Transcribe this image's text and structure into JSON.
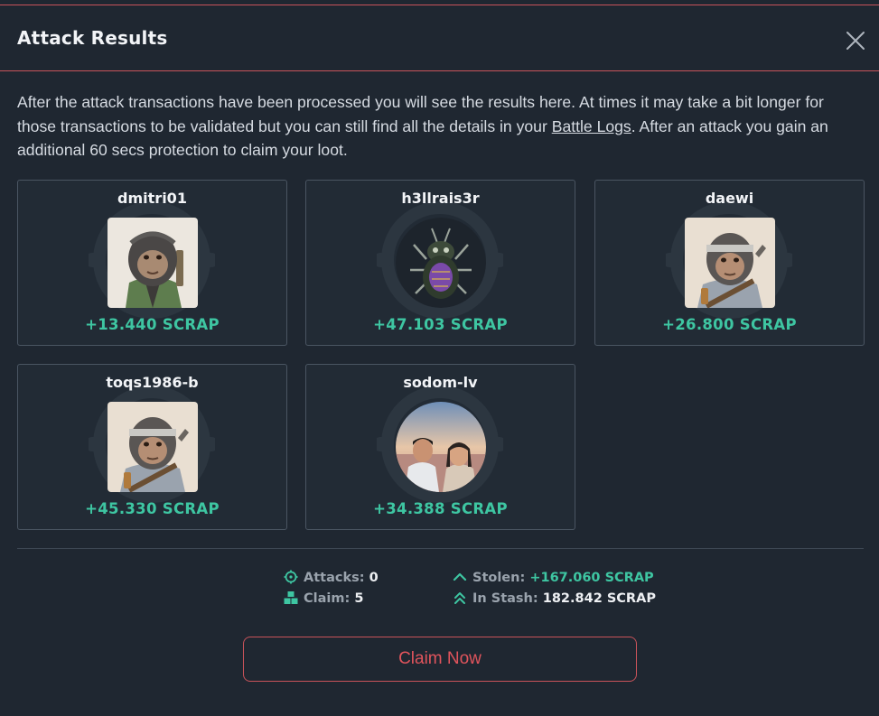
{
  "modal": {
    "title": "Attack Results",
    "close_icon": "close-icon",
    "description_part1": "After the attack transactions have been processed you will see the results here. At times it may take a bit longer for those transactions to be validated but you can still find all the details in your ",
    "battle_logs_link": "Battle Logs",
    "description_part2": ". After an attack you gain an additional 60 secs protection to claim your loot."
  },
  "results": [
    {
      "username": "dmitri01",
      "reward": "+13.440 SCRAP",
      "avatar": "ape-green-jacket"
    },
    {
      "username": "h3llrais3r",
      "reward": "+47.103 SCRAP",
      "avatar": "beetle-bug"
    },
    {
      "username": "daewi",
      "reward": "+26.800 SCRAP",
      "avatar": "ape-headband"
    },
    {
      "username": "toqs1986-b",
      "reward": "+45.330 SCRAP",
      "avatar": "ape-headband"
    },
    {
      "username": "sodom-lv",
      "reward": "+34.388 SCRAP",
      "avatar": "couple-photo"
    }
  ],
  "stats": {
    "attacks_label": "Attacks:",
    "attacks_value": "0",
    "claim_label": "Claim:",
    "claim_value": "5",
    "stolen_label": "Stolen:",
    "stolen_value": "+167.060 SCRAP",
    "stash_label": "In Stash:",
    "stash_value": "182.842 SCRAP"
  },
  "claim_button": {
    "label": "Claim Now"
  },
  "colors": {
    "accent_red": "#c8535a",
    "reward_green": "#3ec6a2",
    "background": "#1f2731"
  }
}
